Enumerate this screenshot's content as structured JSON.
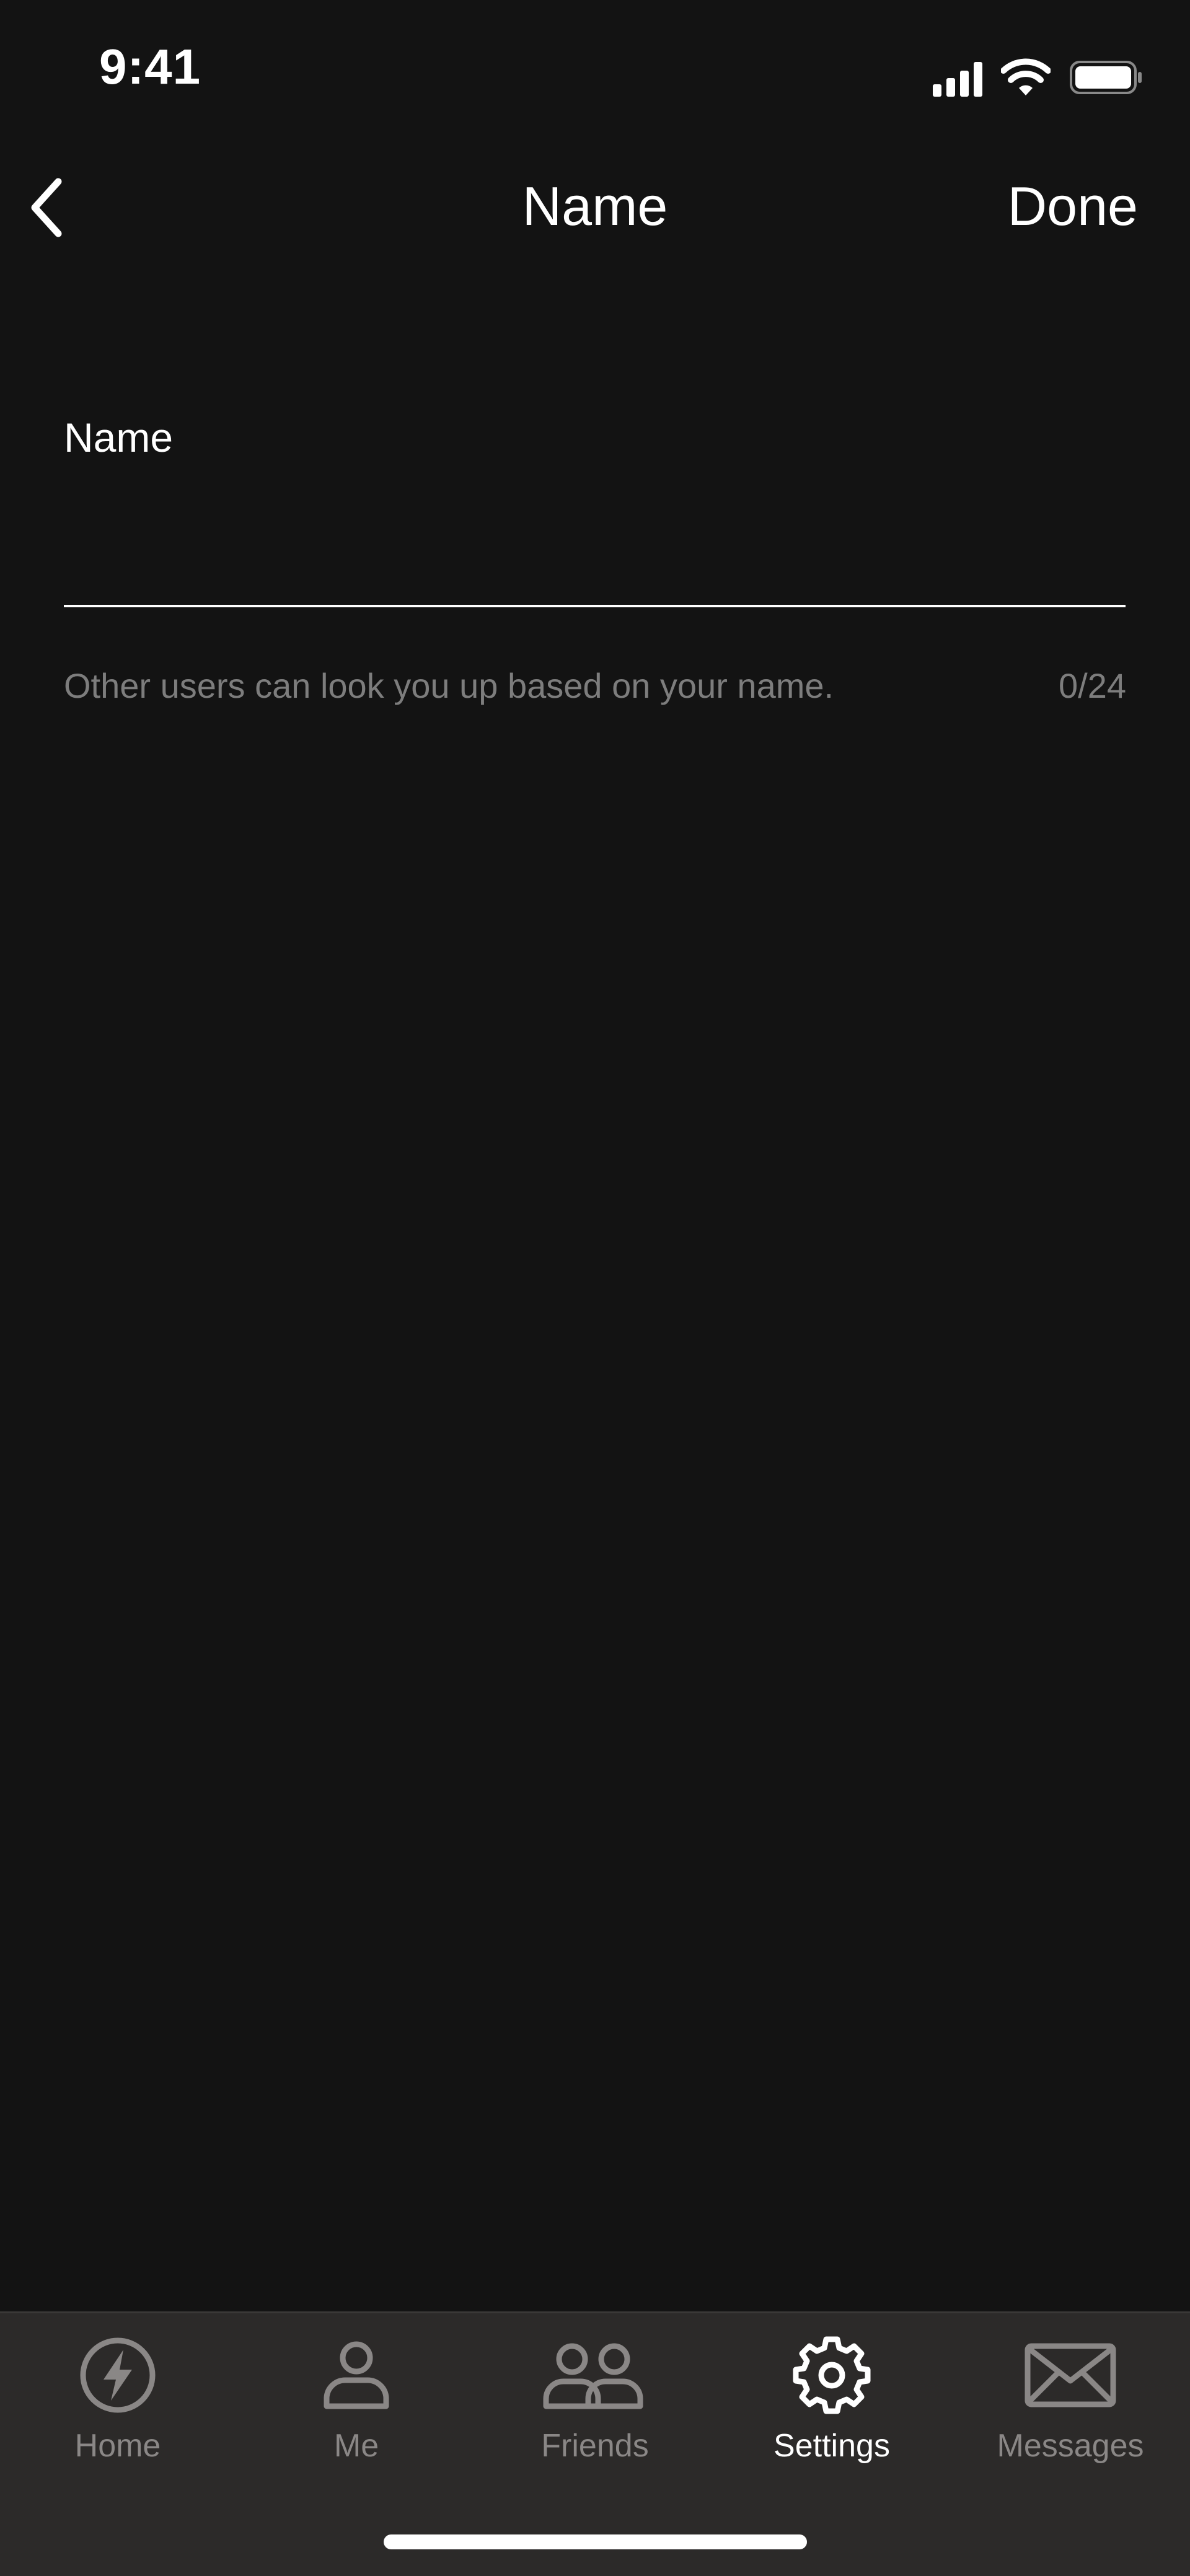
{
  "status_bar": {
    "time": "9:41"
  },
  "nav": {
    "title": "Name",
    "done_label": "Done",
    "back_icon": "chevron-left-icon"
  },
  "form": {
    "label": "Name",
    "value": "",
    "placeholder": "",
    "helper_text": "Other users can look you up based on your name.",
    "counter": "0/24"
  },
  "tabs": [
    {
      "label": "Home",
      "icon": "lightning-icon",
      "active": false
    },
    {
      "label": "Me",
      "icon": "person-icon",
      "active": false
    },
    {
      "label": "Friends",
      "icon": "people-icon",
      "active": false
    },
    {
      "label": "Settings",
      "icon": "gear-icon",
      "active": true
    },
    {
      "label": "Messages",
      "icon": "envelope-icon",
      "active": false
    }
  ],
  "colors": {
    "background": "#131313",
    "tab_bar": "#2c2a29",
    "inactive": "#8a8786",
    "active": "#ffffff",
    "helper": "#7d7d7d"
  }
}
